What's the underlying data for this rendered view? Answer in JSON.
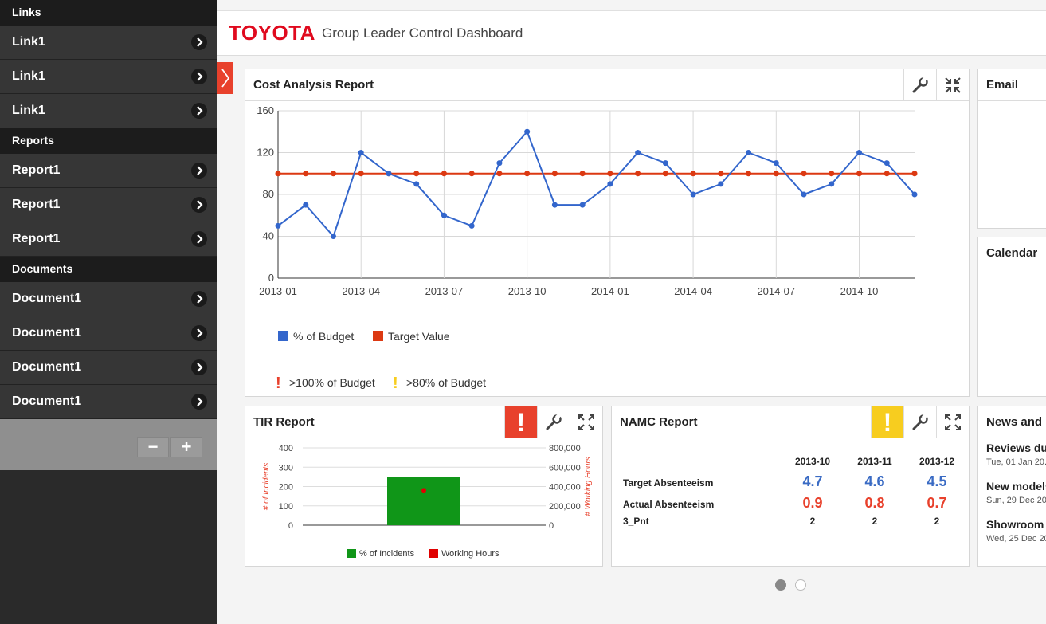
{
  "sidebar": {
    "sections": [
      {
        "title": "Links",
        "items": [
          "Link1",
          "Link1",
          "Link1"
        ]
      },
      {
        "title": "Reports",
        "items": [
          "Report1",
          "Report1",
          "Report1"
        ]
      },
      {
        "title": "Documents",
        "items": [
          "Document1",
          "Document1",
          "Document1",
          "Document1"
        ]
      }
    ],
    "minus_label": "−",
    "plus_label": "+"
  },
  "header": {
    "logo": "TOYOTA",
    "title": "Group Leader Control Dashboard"
  },
  "panels": {
    "cost": {
      "title": "Cost Analysis Report"
    },
    "email": {
      "title": "Email"
    },
    "calendar": {
      "title": "Calendar"
    },
    "tir": {
      "title": "TIR Report",
      "alert": "!"
    },
    "namc": {
      "title": "NAMC Report",
      "alert": "!"
    },
    "news": {
      "title": "News and ..."
    }
  },
  "cost_legend": {
    "series1": "% of Budget",
    "series2": "Target Value",
    "alert_red": ">100% of Budget",
    "alert_yellow": ">80% of Budget",
    "alert_mark": "!"
  },
  "namc": {
    "columns": [
      "2013-10",
      "2013-11",
      "2013-12"
    ],
    "rows": [
      {
        "label": "Target Absenteeism",
        "values": [
          "4.7",
          "4.6",
          "4.5"
        ],
        "color": "#3a6bc4"
      },
      {
        "label": "Actual Absenteeism",
        "values": [
          "0.9",
          "0.8",
          "0.7"
        ],
        "color": "#e8412c"
      },
      {
        "label": "3_Pnt",
        "values": [
          "2",
          "2",
          "2"
        ],
        "color": "#222222"
      }
    ]
  },
  "news": [
    {
      "title": "Reviews du...",
      "date": "Tue, 01 Jan 20..."
    },
    {
      "title": "New models...",
      "date": "Sun, 29 Dec 20..."
    },
    {
      "title": "Showroom ...",
      "date": "Wed, 25 Dec 20..."
    }
  ],
  "colors": {
    "budget": "#3366cc",
    "target": "#dc3912",
    "alert_red": "#e8412c",
    "alert_yellow": "#f7cd1f",
    "tir_bar": "#109618",
    "brand": "#e00a1e"
  },
  "chart_data": [
    {
      "type": "line",
      "x": [
        "2013-01",
        "2013-02",
        "2013-03",
        "2013-04",
        "2013-05",
        "2013-06",
        "2013-07",
        "2013-08",
        "2013-09",
        "2013-10",
        "2013-11",
        "2013-12",
        "2014-01",
        "2014-02",
        "2014-03",
        "2014-04",
        "2014-05",
        "2014-06",
        "2014-07",
        "2014-08",
        "2014-09",
        "2014-10",
        "2014-11",
        "2014-12"
      ],
      "xticks": [
        "2013-01",
        "2013-04",
        "2013-07",
        "2013-10",
        "2014-01",
        "2014-04",
        "2014-07",
        "2014-10"
      ],
      "series": [
        {
          "name": "% of Budget",
          "values": [
            50,
            70,
            40,
            120,
            100,
            90,
            60,
            50,
            110,
            140,
            70,
            70,
            90,
            120,
            110,
            80,
            90,
            120,
            110,
            80,
            90,
            120,
            110,
            80
          ]
        },
        {
          "name": "Target Value",
          "values": [
            100,
            100,
            100,
            100,
            100,
            100,
            100,
            100,
            100,
            100,
            100,
            100,
            100,
            100,
            100,
            100,
            100,
            100,
            100,
            100,
            100,
            100,
            100,
            100
          ]
        }
      ],
      "ylim": [
        0,
        160
      ],
      "yticks": [
        0,
        40,
        80,
        120,
        160
      ],
      "grid": true,
      "legend": "bottom-left"
    },
    {
      "type": "bar",
      "series": [
        {
          "name": "% of Incidents",
          "values": [
            250
          ],
          "axis": "left"
        },
        {
          "name": "Working Hours",
          "values": [
            360000
          ],
          "axis": "right"
        }
      ],
      "ylabel": "# of Incidents",
      "ylabel_right": "# Working Hours",
      "ylim": [
        0,
        400
      ],
      "ylim_right": [
        0,
        800000
      ],
      "yticks": [
        "0",
        "100",
        "200",
        "300",
        "400"
      ],
      "yticks_right": [
        "0",
        "200,000",
        "400,000",
        "600,000",
        "800,000"
      ],
      "legend": "bottom"
    }
  ]
}
